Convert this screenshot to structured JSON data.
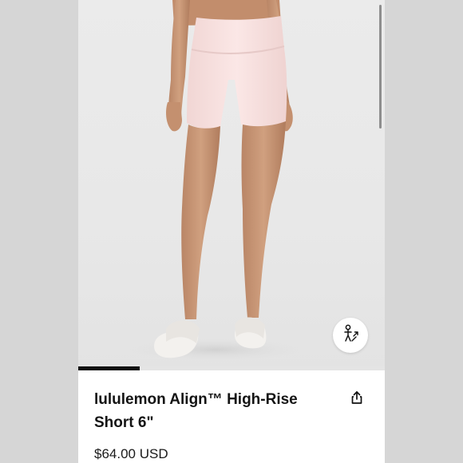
{
  "product": {
    "title": "lululemon Align™ High-Rise Short 6\"",
    "price": "$64.00 USD"
  },
  "gallery": {
    "image_subject": "model-wearing-light-pink-high-rise-shorts-and-white-slides",
    "progress_fraction": 0.2,
    "product_color": "#f6dede",
    "background_color": "#e9e9e9"
  },
  "icons": {
    "try_on": "virtual-try-on-icon",
    "share": "share-icon"
  }
}
